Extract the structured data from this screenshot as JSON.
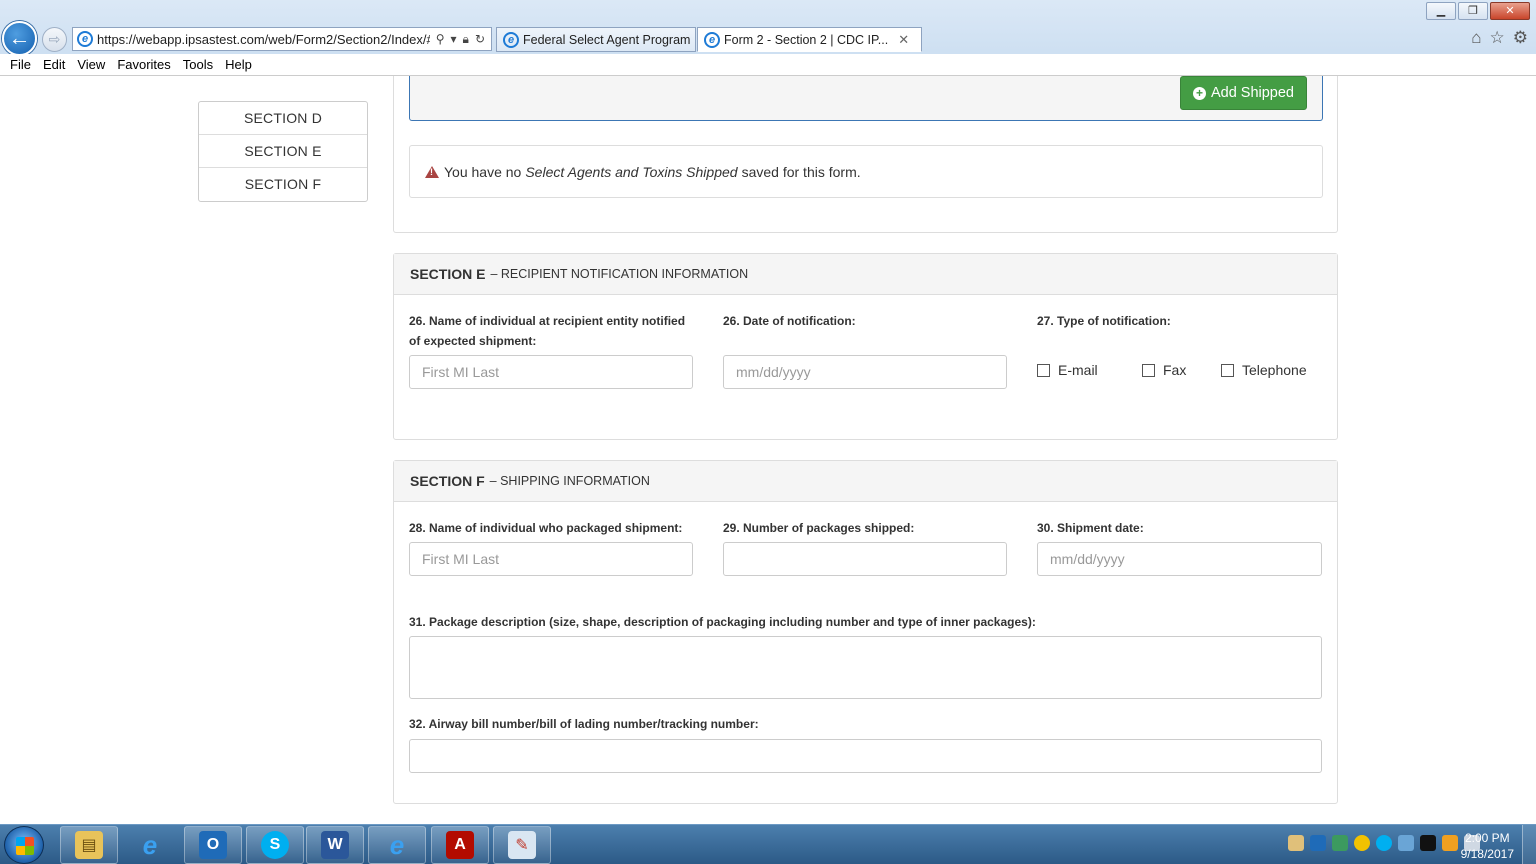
{
  "browser": {
    "url": "https://webapp.ipsastest.com/web/Form2/Section2/Index/#/",
    "tabs": [
      {
        "label": "Federal Select Agent Program ..."
      },
      {
        "label": "Form 2 - Section 2 | CDC IP...",
        "close": "✕"
      }
    ],
    "window_controls": [
      "▁",
      "❐",
      "✕"
    ],
    "menu": [
      "File",
      "Edit",
      "View",
      "Favorites",
      "Tools",
      "Help"
    ]
  },
  "sidenav": {
    "items": [
      "SECTION D",
      "SECTION E",
      "SECTION F"
    ]
  },
  "section_d": {
    "add_button": "Add Shipped",
    "alert": {
      "prefix": "You have no",
      "emphasis": "Select Agents and Toxins Shipped",
      "suffix": "saved for this form."
    }
  },
  "section_e": {
    "title_bold": "SECTION E",
    "title_rest": "– RECIPIENT NOTIFICATION INFORMATION",
    "field_26a_label": "26. Name of individual at recipient entity notified of expected shipment:",
    "field_26a_placeholder": "First MI Last",
    "field_26b_label": "26. Date of notification:",
    "field_26b_placeholder": "mm/dd/yyyy",
    "field_27_label": "27. Type of notification:",
    "options": [
      "E-mail",
      "Fax",
      "Telephone"
    ]
  },
  "section_f": {
    "title_bold": "SECTION F",
    "title_rest": "– SHIPPING INFORMATION",
    "field_28_label": "28. Name of individual who packaged shipment:",
    "field_28_placeholder": "First MI Last",
    "field_29_label": "29. Number of packages shipped:",
    "field_30_label": "30. Shipment date:",
    "field_30_placeholder": "mm/dd/yyyy",
    "field_31_label": "31. Package description (size, shape, description of packaging including number and type of inner packages):",
    "field_32_label": "32. Airway bill number/bill of lading number/tracking number:"
  },
  "taskbar": {
    "time": "2:00 PM",
    "date": "9/18/2017"
  }
}
